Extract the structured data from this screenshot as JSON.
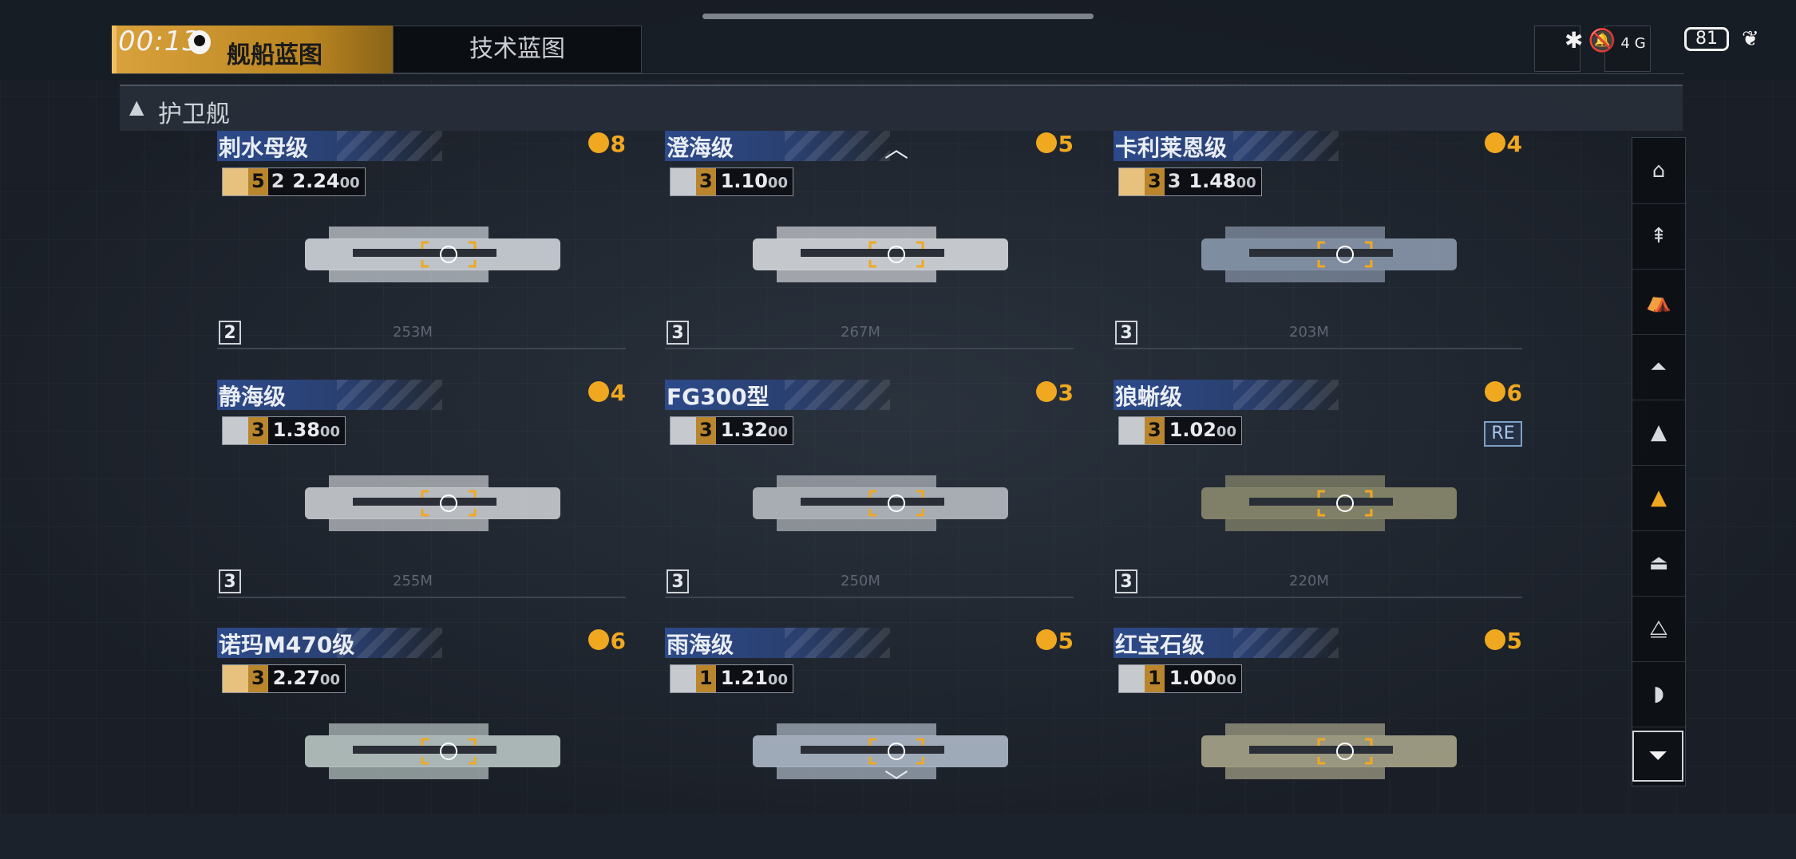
{
  "status": {
    "time": "00:13",
    "battery": "81",
    "network": "4G"
  },
  "tabs": {
    "ships": "舰船蓝图",
    "tech": "技术蓝图"
  },
  "section": {
    "title": "护卫舰"
  },
  "cards": [
    {
      "name": "刺水母级",
      "rank": "8",
      "count": "5",
      "count2": "2",
      "value": "2.24",
      "value_suffix": "00",
      "tier": "2",
      "length": "253M",
      "stat_style": "gold"
    },
    {
      "name": "澄海级",
      "rank": "5",
      "count": "3",
      "value": "1.10",
      "value_suffix": "00",
      "tier": "3",
      "length": "267M",
      "stat_style": "gray"
    },
    {
      "name": "卡利莱恩级",
      "rank": "4",
      "count": "3",
      "count2": "3",
      "value": "1.48",
      "value_suffix": "00",
      "tier": "3",
      "length": "203M",
      "stat_style": "gold"
    },
    {
      "name": "静海级",
      "rank": "4",
      "count": "3",
      "value": "1.38",
      "value_suffix": "00",
      "tier": "3",
      "length": "255M",
      "stat_style": "gray"
    },
    {
      "name": "FG300型",
      "rank": "3",
      "count": "3",
      "value": "1.32",
      "value_suffix": "00",
      "tier": "3",
      "length": "250M",
      "stat_style": "gray"
    },
    {
      "name": "狼蜥级",
      "rank": "6",
      "count": "3",
      "value": "1.02",
      "value_suffix": "00",
      "tier": "3",
      "length": "220M",
      "stat_style": "gray",
      "badge": "RE"
    },
    {
      "name": "诺玛M470级",
      "rank": "6",
      "count": "3",
      "value": "2.27",
      "value_suffix": "00",
      "stat_style": "gold"
    },
    {
      "name": "雨海级",
      "rank": "5",
      "count": "1",
      "value": "1.21",
      "value_suffix": "00",
      "stat_style": "gray"
    },
    {
      "name": "红宝石级",
      "rank": "5",
      "count": "1",
      "value": "1.00",
      "value_suffix": "00",
      "stat_style": "gray"
    }
  ],
  "sidebar": {
    "items": [
      "carrier-class-icon",
      "battlecruiser-class-icon",
      "cruiser-class-icon",
      "destroyer-class-icon",
      "frigate-class-icon",
      "corvette-class-icon",
      "aircraft-class-icon",
      "fighter-class-icon",
      "support-class-icon"
    ],
    "active_index": 5
  },
  "colors": {
    "accent": "#f0a820",
    "tab_active": "#d9a13b",
    "name_bar": "#2c4a8a"
  }
}
